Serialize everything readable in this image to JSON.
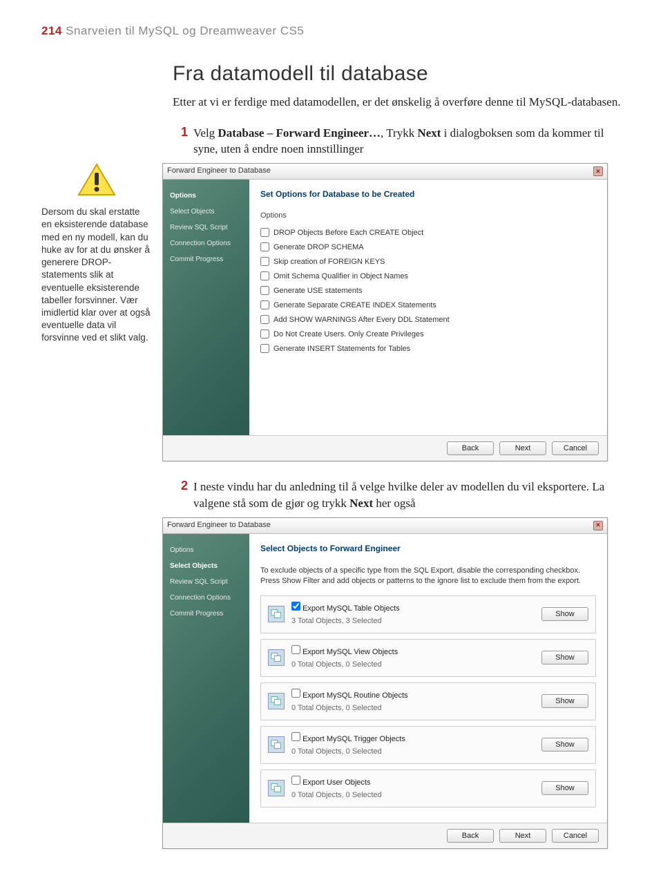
{
  "header": {
    "page_num": "214",
    "title": "Snarveien til MySQL og Dreamweaver CS5"
  },
  "heading": "Fra datamodell til database",
  "intro": "Etter at vi er ferdige med datamodellen, er det ønskelig å overføre denne til MySQL-databasen.",
  "step1": {
    "num": "1",
    "text_pre": "Velg ",
    "text_b1": "Database – Forward Engineer…",
    "text_mid": ", Trykk ",
    "text_b2": "Next",
    "text_post": " i dialogboksen som da kommer til syne, uten å endre noen innstillinger"
  },
  "sidebar_note": "Dersom du skal erstatte en eksisterende database med en ny modell, kan du huke av for at du ønsker å generere DROP-statements slik at eventuelle eksisterende tabeller forsvinner. Vær imidlertid klar over at også eventuelle data vil forsvinne ved et slikt valg.",
  "dialog1": {
    "title": "Forward Engineer to Database",
    "side": [
      "Options",
      "Select Objects",
      "Review SQL Script",
      "Connection Options",
      "Commit Progress"
    ],
    "section_title": "Set Options for Database to be Created",
    "options_label": "Options",
    "checkboxes": [
      "DROP Objects Before Each CREATE Object",
      "Generate DROP SCHEMA",
      "Skip creation of FOREIGN KEYS",
      "Omit Schema Qualifier in Object Names",
      "Generate USE statements",
      "Generate Separate CREATE INDEX Statements",
      "Add SHOW WARNINGS After Every DDL Statement",
      "Do Not Create Users. Only Create Privileges",
      "Generate INSERT Statements for Tables"
    ],
    "buttons": {
      "back": "Back",
      "next": "Next",
      "cancel": "Cancel"
    }
  },
  "step2": {
    "num": "2",
    "text_pre": "I neste vindu har du anledning til å velge hvilke deler av modellen du vil eksportere. La valgene stå som de gjør og trykk ",
    "text_b1": "Next",
    "text_post": " her også"
  },
  "dialog2": {
    "title": "Forward Engineer to Database",
    "side": [
      "Options",
      "Select Objects",
      "Review SQL Script",
      "Connection Options",
      "Commit Progress"
    ],
    "section_title": "Select Objects to Forward Engineer",
    "desc": "To exclude objects of a specific type from the SQL Export, disable the corresponding checkbox. Press Show Filter and add objects or patterns to the ignore list to exclude them from the export.",
    "exports": [
      {
        "label": "Export MySQL Table Objects",
        "sub": "3 Total Objects, 3 Selected",
        "checked": true
      },
      {
        "label": "Export MySQL View Objects",
        "sub": "0 Total Objects, 0 Selected",
        "checked": false
      },
      {
        "label": "Export MySQL Routine Objects",
        "sub": "0 Total Objects, 0 Selected",
        "checked": false
      },
      {
        "label": "Export MySQL Trigger Objects",
        "sub": "0 Total Objects, 0 Selected",
        "checked": false
      },
      {
        "label": "Export User Objects",
        "sub": "0 Total Objects, 0 Selected",
        "checked": false
      }
    ],
    "show_btn": "Show",
    "buttons": {
      "back": "Back",
      "next": "Next",
      "cancel": "Cancel"
    }
  }
}
